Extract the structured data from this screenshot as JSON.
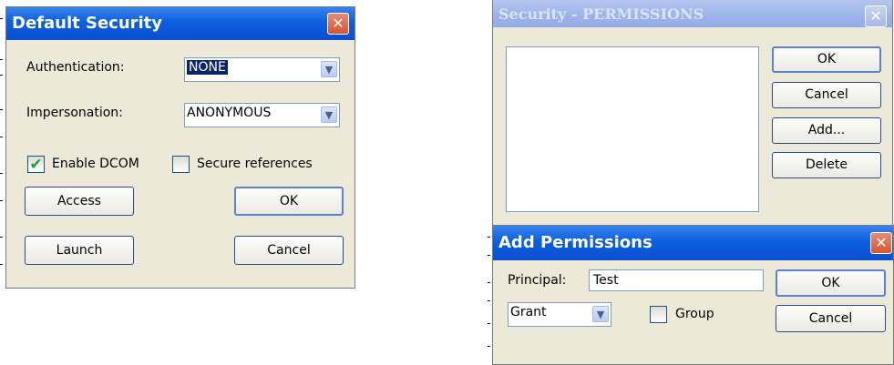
{
  "default_security": {
    "title": "Default Security",
    "close_glyph": "✕",
    "authentication_label": "Authentication:",
    "authentication_value": "NONE",
    "impersonation_label": "Impersonation:",
    "impersonation_value": "ANONYMOUS",
    "enable_dcom_label": "Enable DCOM",
    "enable_dcom_checked": true,
    "secure_references_label": "Secure references",
    "secure_references_checked": false,
    "access_label": "Access",
    "ok_label": "OK",
    "launch_label": "Launch",
    "cancel_label": "Cancel"
  },
  "security_permissions": {
    "title": "Security - PERMISSIONS",
    "close_glyph": "✕",
    "ok_label": "OK",
    "cancel_label": "Cancel",
    "add_label": "Add...",
    "delete_label": "Delete",
    "list_items": []
  },
  "add_permissions": {
    "title": "Add Permissions",
    "close_glyph": "✕",
    "principal_label": "Principal:",
    "principal_value": "Test",
    "grant_value": "Grant",
    "group_label": "Group",
    "group_checked": false,
    "ok_label": "OK",
    "cancel_label": "Cancel"
  },
  "icons": {
    "dropdown_arrow": "chevron-down-icon",
    "checkmark": "check-icon",
    "close": "close-icon"
  },
  "colors": {
    "active_title": "#0b5fe0",
    "inactive_title": "#9db4ea",
    "dialog_bg": "#ece9d8",
    "close_red": "#d5562f",
    "check_green": "#21a121"
  }
}
